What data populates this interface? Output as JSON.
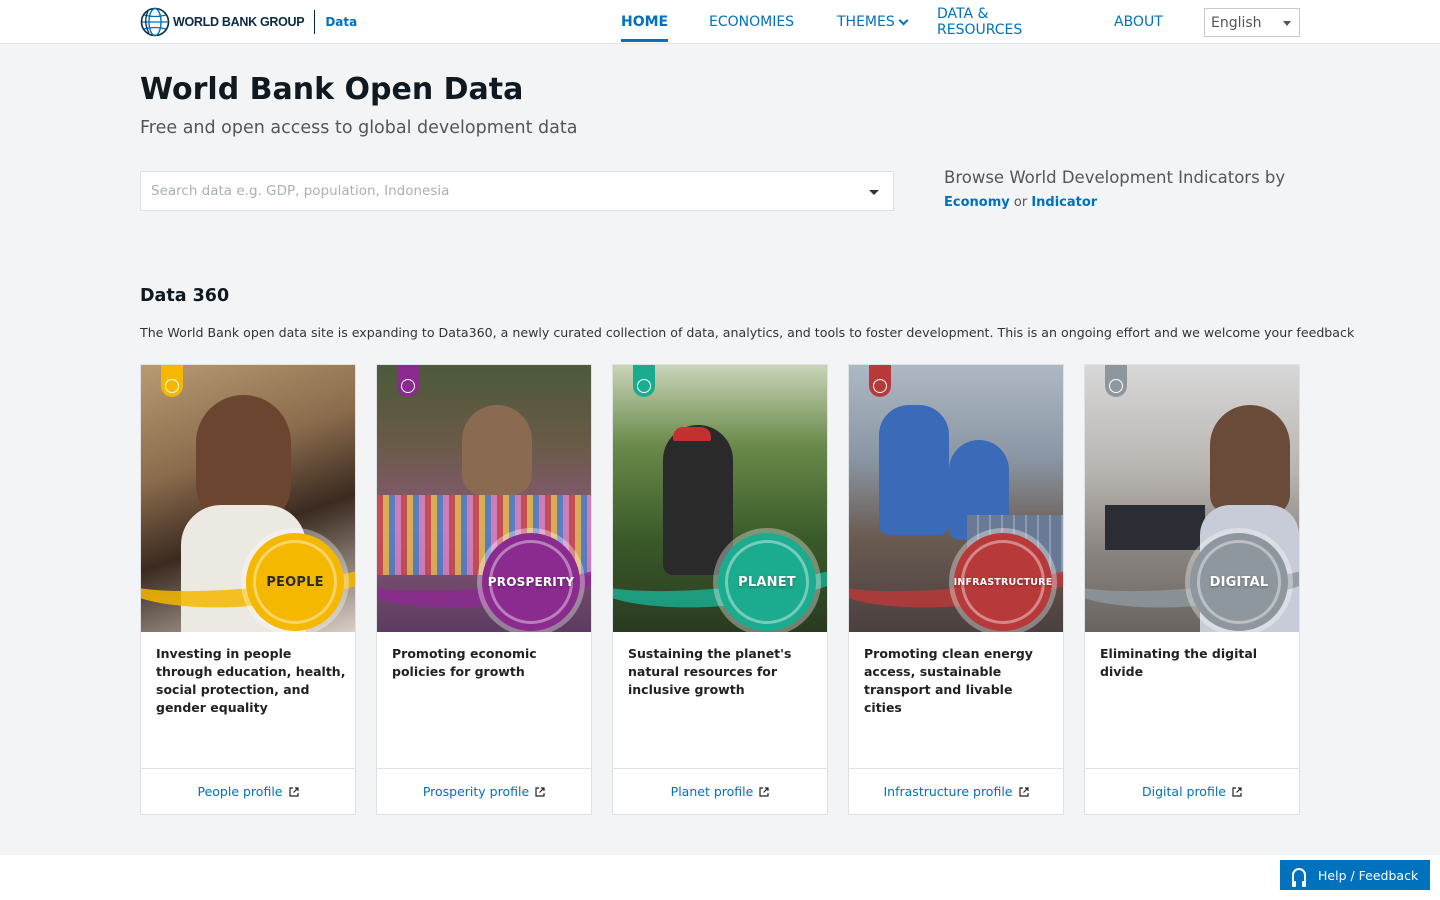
{
  "header": {
    "brand_name": "WORLD BANK GROUP",
    "brand_section": "Data",
    "nav": [
      {
        "label": "HOME"
      },
      {
        "label": "ECONOMIES"
      },
      {
        "label": "THEMES"
      },
      {
        "label": "DATA & RESOURCES"
      },
      {
        "label": "ABOUT"
      }
    ],
    "language": "English",
    "accent_color": "#0071bc"
  },
  "hero": {
    "title": "World Bank Open Data",
    "subtitle": "Free and open access to global development data",
    "search_placeholder": "Search data e.g. GDP, population, Indonesia",
    "browse_title": "Browse World Development Indicators by",
    "browse_economy": "Economy",
    "browse_or": "or",
    "browse_indicator": "Indicator"
  },
  "data360": {
    "title": "Data 360",
    "description": "The World Bank open data site is expanding to Data360, a newly curated collection of data, analytics, and tools to foster development. This is an ongoing effort and we welcome your feedback",
    "cards": [
      {
        "label": "PEOPLE",
        "text": "Investing in people through education, health, social protection, and gender equality",
        "link": "People profile",
        "color": "#f5b800"
      },
      {
        "label": "PROSPERITY",
        "text": "Promoting economic policies for growth",
        "link": "Prosperity profile",
        "color": "#8b2a8f"
      },
      {
        "label": "PLANET",
        "text": "Sustaining the planet's natural resources for inclusive growth",
        "link": "Planet profile",
        "color": "#1bab8e"
      },
      {
        "label": "INFRASTRUCTURE",
        "text": "Promoting clean energy access, sustainable transport and livable cities",
        "link": "Infrastructure profile",
        "color": "#b8393a"
      },
      {
        "label": "DIGITAL",
        "text": "Eliminating the digital divide",
        "link": "Digital profile",
        "color": "#8e979d"
      }
    ]
  },
  "help": {
    "label": "Help / Feedback"
  }
}
